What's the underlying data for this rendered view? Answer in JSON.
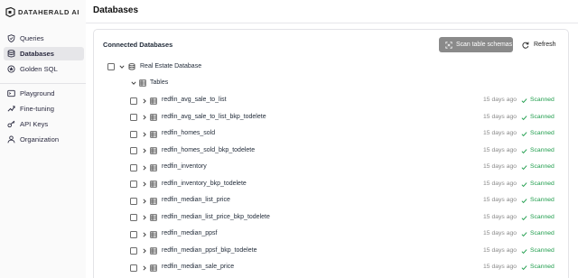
{
  "app": {
    "brand": "DATAHERALD AI",
    "page_title": "Databases"
  },
  "sidebar": {
    "items": [
      {
        "label": "Queries",
        "icon": "shield-icon",
        "active": false
      },
      {
        "label": "Databases",
        "icon": "database-icon",
        "active": true
      },
      {
        "label": "Golden SQL",
        "icon": "golden-sql-icon",
        "active": false
      },
      {
        "label": "Playground",
        "icon": "terminal-icon",
        "active": false
      },
      {
        "label": "Fine-tuning",
        "icon": "fine-tuning-icon",
        "active": false
      },
      {
        "label": "API Keys",
        "icon": "key-icon",
        "active": false
      },
      {
        "label": "Organization",
        "icon": "organization-icon",
        "active": false
      }
    ]
  },
  "panel": {
    "title": "Connected Databases",
    "scan_button": "Scan table schemas",
    "refresh_button": "Refresh",
    "database": {
      "name": "Real Estate Database"
    },
    "tables_group": {
      "label": "Tables"
    },
    "tables": [
      {
        "name": "redfin_avg_sale_to_list",
        "age": "15 days ago",
        "status": "Scanned"
      },
      {
        "name": "redfin_avg_sale_to_list_bkp_todelete",
        "age": "15 days ago",
        "status": "Scanned"
      },
      {
        "name": "redfin_homes_sold",
        "age": "15 days ago",
        "status": "Scanned"
      },
      {
        "name": "redfin_homes_sold_bkp_todelete",
        "age": "15 days ago",
        "status": "Scanned"
      },
      {
        "name": "redfin_inventory",
        "age": "15 days ago",
        "status": "Scanned"
      },
      {
        "name": "redfin_inventory_bkp_todelete",
        "age": "15 days ago",
        "status": "Scanned"
      },
      {
        "name": "redfin_median_list_price",
        "age": "15 days ago",
        "status": "Scanned"
      },
      {
        "name": "redfin_median_list_price_bkp_todelete",
        "age": "15 days ago",
        "status": "Scanned"
      },
      {
        "name": "redfin_median_ppsf",
        "age": "15 days ago",
        "status": "Scanned"
      },
      {
        "name": "redfin_median_ppsf_bkp_todelete",
        "age": "15 days ago",
        "status": "Scanned"
      },
      {
        "name": "redfin_median_sale_price",
        "age": "15 days ago",
        "status": "Scanned"
      }
    ]
  },
  "colors": {
    "status_green": "#1f9d4c",
    "scan_button_bg": "#8a8a8a",
    "sidebar_active_bg": "#e6e6e9"
  }
}
